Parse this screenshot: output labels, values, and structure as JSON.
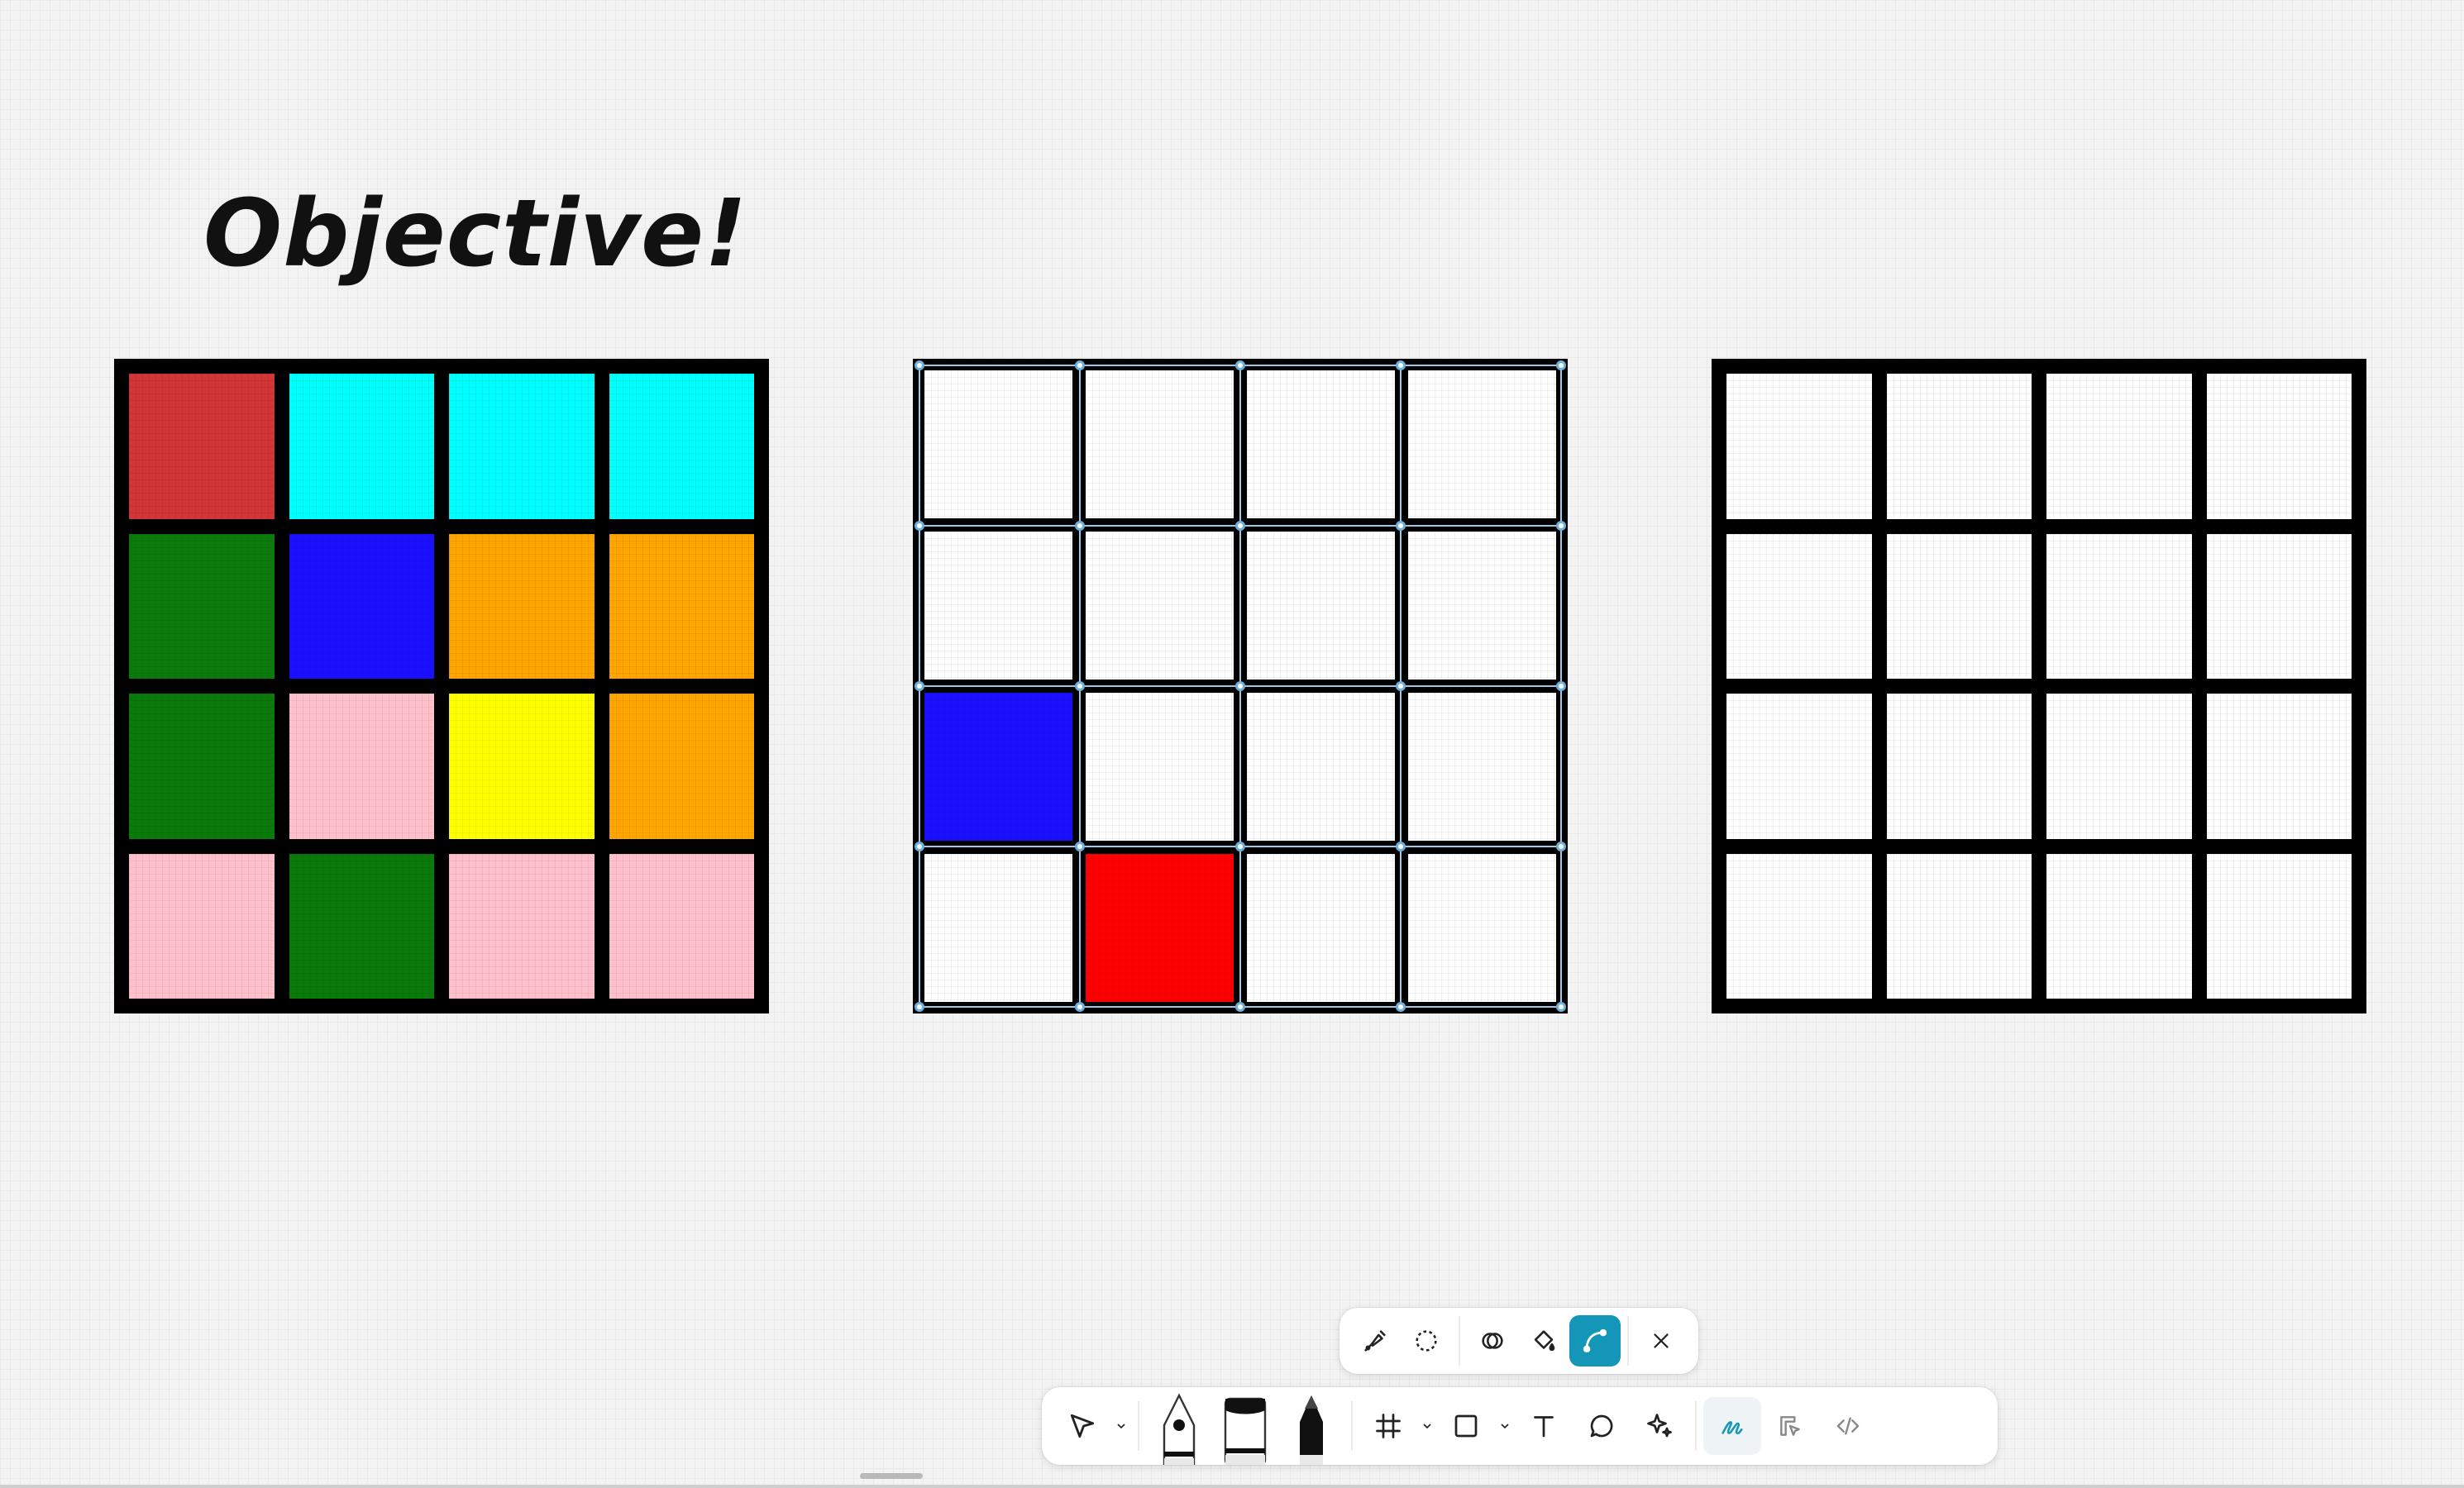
{
  "title": "Objective!",
  "colors": {
    "red_muted": "#d13535",
    "cyan": "#00ffff",
    "green": "#0a7a0a",
    "blue": "#1a10ff",
    "orange": "#ffa500",
    "pink": "#ffc0cb",
    "yellow": "#ffff00",
    "red": "#ff0000",
    "white": "#ffffff",
    "accent": "#1496b8"
  },
  "grids": [
    {
      "name": "objective-grid",
      "cells": [
        [
          "red_muted",
          "cyan",
          "cyan",
          "cyan"
        ],
        [
          "green",
          "blue",
          "orange",
          "orange"
        ],
        [
          "green",
          "pink",
          "yellow",
          "orange"
        ],
        [
          "pink",
          "green",
          "pink",
          "pink"
        ]
      ]
    },
    {
      "name": "working-grid",
      "selected": true,
      "cells": [
        [
          "white",
          "white",
          "white",
          "white"
        ],
        [
          "white",
          "white",
          "white",
          "white"
        ],
        [
          "blue",
          "white",
          "white",
          "white"
        ],
        [
          "white",
          "red",
          "white",
          "white"
        ]
      ]
    },
    {
      "name": "blank-grid",
      "cells": [
        [
          "white",
          "white",
          "white",
          "white"
        ],
        [
          "white",
          "white",
          "white",
          "white"
        ],
        [
          "white",
          "white",
          "white",
          "white"
        ],
        [
          "white",
          "white",
          "white",
          "white"
        ]
      ]
    }
  ],
  "toolbar_top": {
    "icons": [
      "lasso-pen-icon",
      "lasso-icon",
      "shape-combine-icon",
      "fill-bucket-icon",
      "curve-path-icon",
      "close-icon"
    ],
    "active": "curve-path-icon"
  },
  "toolbar_main": {
    "icons": [
      "move-arrow-icon",
      "pen-tool-icon",
      "marker-tool-icon",
      "pencil-tool-icon",
      "frame-icon",
      "rectangle-icon",
      "text-icon",
      "comment-icon",
      "ai-sparkle-icon",
      "draw-mode-icon",
      "design-mode-icon",
      "dev-mode-icon"
    ],
    "active": "draw-mode-icon"
  }
}
